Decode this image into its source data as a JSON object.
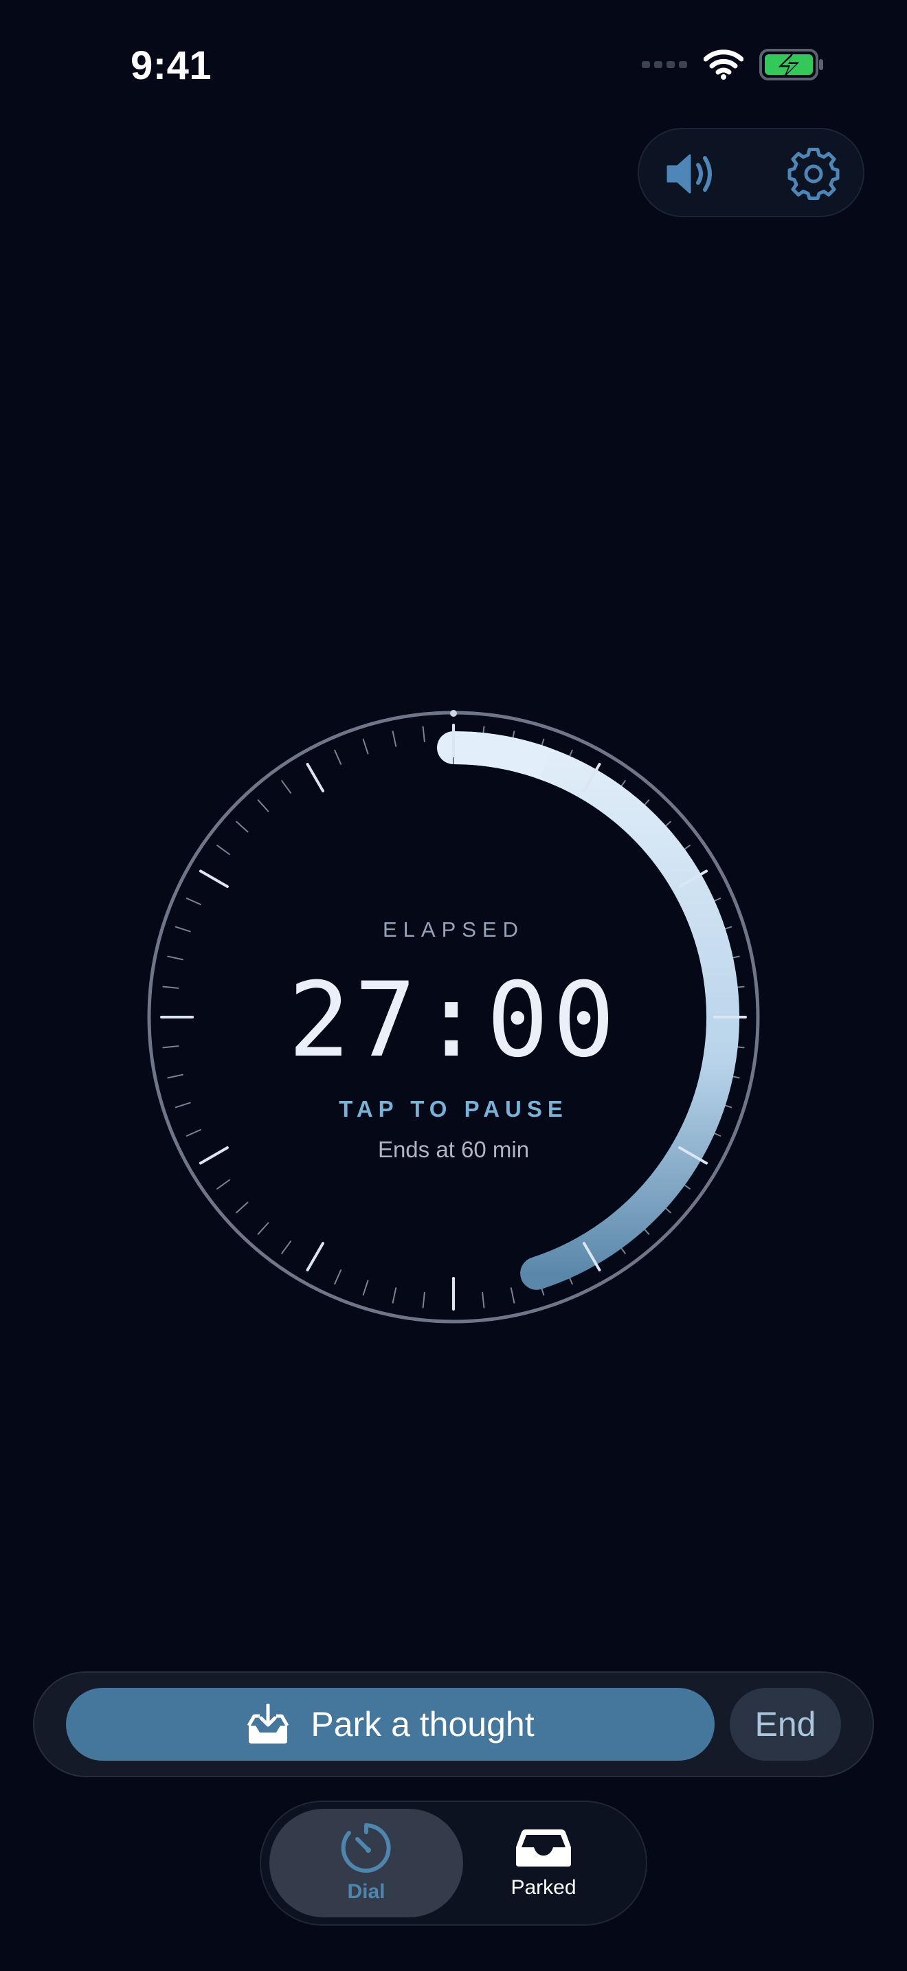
{
  "status_bar": {
    "time": "9:41",
    "icons": [
      "cellular-signal-icon",
      "wifi-icon",
      "battery-charging-icon"
    ]
  },
  "top_controls": {
    "sound_icon": "speaker-icon",
    "settings_icon": "gear-icon"
  },
  "dial": {
    "elapsed_label": "ELAPSED",
    "time": "27:00",
    "action_label": "TAP TO PAUSE",
    "ends_label": "Ends at 60 min",
    "progress_fraction": 0.45,
    "elapsed_minutes": 27,
    "total_minutes": 60
  },
  "action_bar": {
    "park_label": "Park a thought",
    "park_icon": "tray-download-icon",
    "end_label": "End"
  },
  "tab_bar": {
    "tabs": [
      {
        "label": "Dial",
        "icon": "dial-timer-icon",
        "active": true
      },
      {
        "label": "Parked",
        "icon": "inbox-tray-icon",
        "active": false
      }
    ]
  },
  "colors": {
    "background": "#040817",
    "accent": "#44779b",
    "progress_light": "#dce9f5",
    "progress_dark": "#5b88aa",
    "active_tab_text": "#4f86b0",
    "battery_green": "#34c759"
  }
}
